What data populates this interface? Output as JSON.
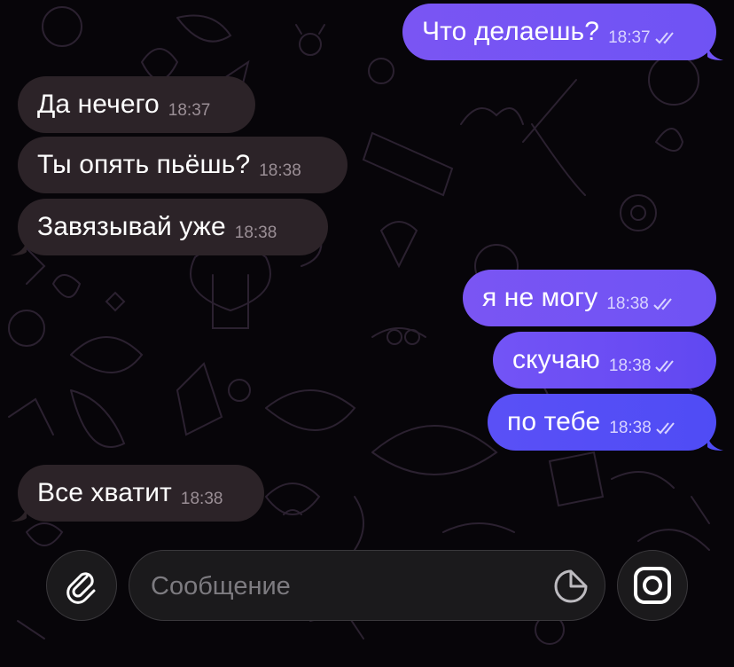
{
  "messages": [
    {
      "direction": "outgoing",
      "text": "Что делаешь?",
      "time": "18:37",
      "read": true
    },
    {
      "direction": "incoming",
      "text": "Да нечего",
      "time": "18:37"
    },
    {
      "direction": "incoming",
      "text": "Ты опять пьёшь?",
      "time": "18:38"
    },
    {
      "direction": "incoming",
      "text": "Завязывай уже",
      "time": "18:38"
    },
    {
      "direction": "outgoing",
      "text": "я не могу",
      "time": "18:38",
      "read": true
    },
    {
      "direction": "outgoing",
      "text": "скучаю",
      "time": "18:38",
      "read": true
    },
    {
      "direction": "outgoing",
      "text": "по тебе",
      "time": "18:38",
      "read": true
    },
    {
      "direction": "incoming",
      "text": "Все хватит",
      "time": "18:38"
    }
  ],
  "composer": {
    "placeholder": "Сообщение",
    "value": "",
    "attach_icon": "paperclip-icon",
    "sticker_icon": "sticker-icon",
    "camera_icon": "camera-icon"
  },
  "colors": {
    "background": "#070509",
    "incoming_bubble": "#2c2328",
    "outgoing_bubble": "#6a4cf3",
    "doodle_stroke": "#2a1f2c"
  }
}
